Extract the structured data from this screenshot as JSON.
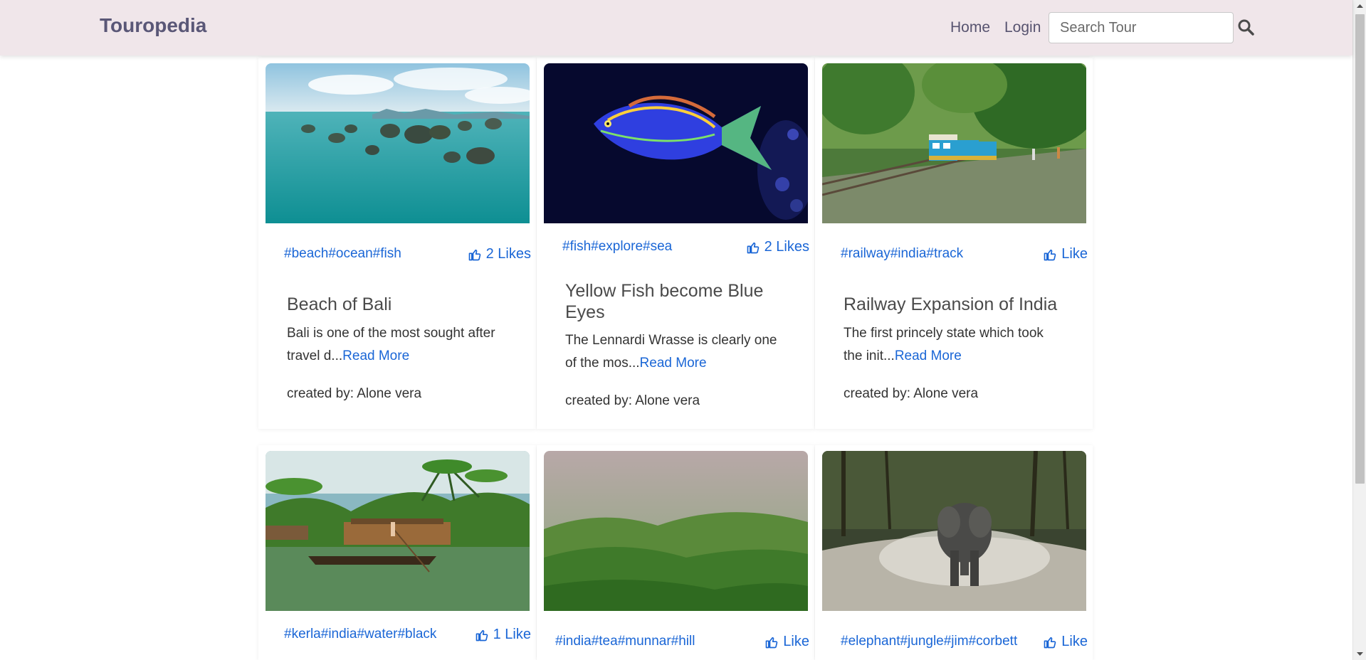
{
  "navbar": {
    "brand": "Touropedia",
    "home": "Home",
    "login": "Login",
    "search_placeholder": "Search Tour",
    "search_icon": "search-icon"
  },
  "cards": [
    {
      "tags": "#beach#ocean#fish",
      "likes": "2 Likes",
      "title": "Beach of Bali",
      "description": "Bali is one of the most sought after travel d...",
      "read_more": "Read More",
      "creator": "created by: Alone vera",
      "image": "ocean-islands-photo"
    },
    {
      "tags": "#fish#explore#sea",
      "likes": "2 Likes",
      "title": "Yellow Fish become Blue Eyes",
      "description": "The Lennardi Wrasse is clearly one of the mos...",
      "read_more": "Read More",
      "creator": "created by: Alone vera",
      "image": "blue-fish-photo"
    },
    {
      "tags": "#railway#india#track",
      "likes": "Like",
      "title": "Railway Expansion of India",
      "description": "The first princely state which took the init...",
      "read_more": "Read More",
      "creator": "created by: Alone vera",
      "image": "toy-train-photo"
    },
    {
      "tags": "#kerla#india#water#black",
      "likes": "1 Like",
      "image": "houseboat-photo"
    },
    {
      "tags": "#india#tea#munnar#hill",
      "likes": "Like",
      "image": "tea-hills-photo"
    },
    {
      "tags": "#elephant#jungle#jim#corbett",
      "likes": "Like",
      "image": "elephant-photo"
    }
  ],
  "colors": {
    "navbar_bg": "#f0e6ea",
    "brand": "#5a5777",
    "link": "#1a66d6"
  }
}
